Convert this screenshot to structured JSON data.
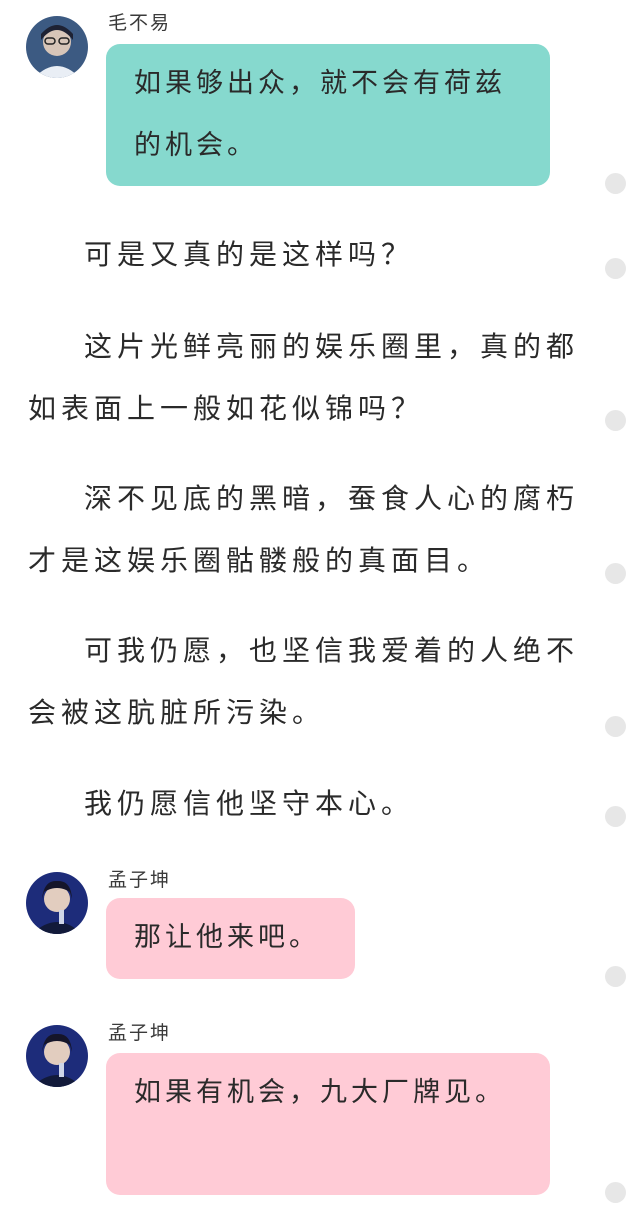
{
  "messages": [
    {
      "sender": "毛不易",
      "text": "如果够出众，就不会有荷兹的机会。"
    },
    {
      "sender": "孟子坤",
      "text": "那让他来吧。"
    },
    {
      "sender": "孟子坤",
      "text": "如果有机会，九大厂牌见。"
    }
  ],
  "paragraphs": [
    "可是又真的是这样吗？",
    "这片光鲜亮丽的娱乐圈里，真的都如表面上一般如花似锦吗？",
    "深不见底的黑暗，蚕食人心的腐朽才是这娱乐圈骷髅般的真面目。",
    "可我仍愿，也坚信我爱着的人绝不会被这肮脏所污染。",
    "我仍愿信他坚守本心。"
  ],
  "colors": {
    "teal_bubble": "#86d9ce",
    "pink_bubble": "#ffcbd6",
    "dot": "#e7e7e7"
  }
}
